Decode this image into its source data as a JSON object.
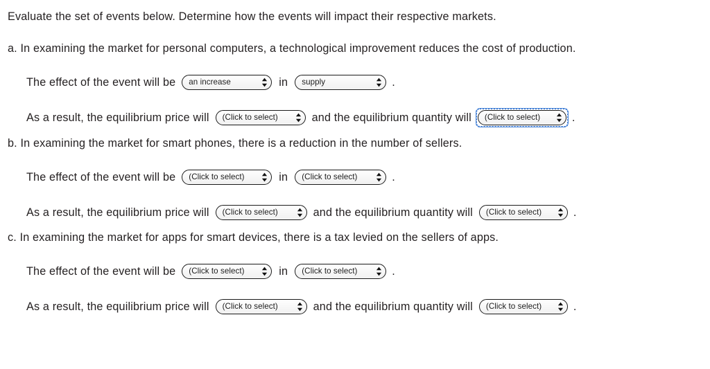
{
  "instructions": "Evaluate the set of events below. Determine how the events will impact their respective markets.",
  "labels": {
    "effect_lead": "The effect of the event will be",
    "effect_mid": "in",
    "result_lead": "As a result, the equilibrium price will",
    "result_mid": "and the equilibrium quantity will",
    "period": "."
  },
  "placeholder": "(Click to select)",
  "icons": {
    "select_arrows": "sort-updown-icon"
  },
  "colors": {
    "text": "#231f20",
    "select_border": "#1a1a1a",
    "select_fill": "#f7f7f7",
    "focus_ring": "#2f6fd0",
    "page_background": "#ffffff"
  },
  "items": [
    {
      "marker": "a.",
      "prompt": "a. In examining the market for personal computers, a technological improvement reduces the cost of production.",
      "effect_value": "an increase",
      "market_value": "supply",
      "price_value": "(Click to select)",
      "quantity_value": "(Click to select)",
      "quantity_focused": true
    },
    {
      "marker": "b.",
      "prompt": "b. In examining the market for smart phones, there is a reduction in the number of sellers.",
      "effect_value": "(Click to select)",
      "market_value": "(Click to select)",
      "price_value": "(Click to select)",
      "quantity_value": "(Click to select)",
      "quantity_focused": false
    },
    {
      "marker": "c.",
      "prompt": "c. In examining the market for apps for smart devices, there is a tax levied on the sellers of apps.",
      "effect_value": "(Click to select)",
      "market_value": "(Click to select)",
      "price_value": "(Click to select)",
      "quantity_value": "(Click to select)",
      "quantity_focused": false
    }
  ]
}
